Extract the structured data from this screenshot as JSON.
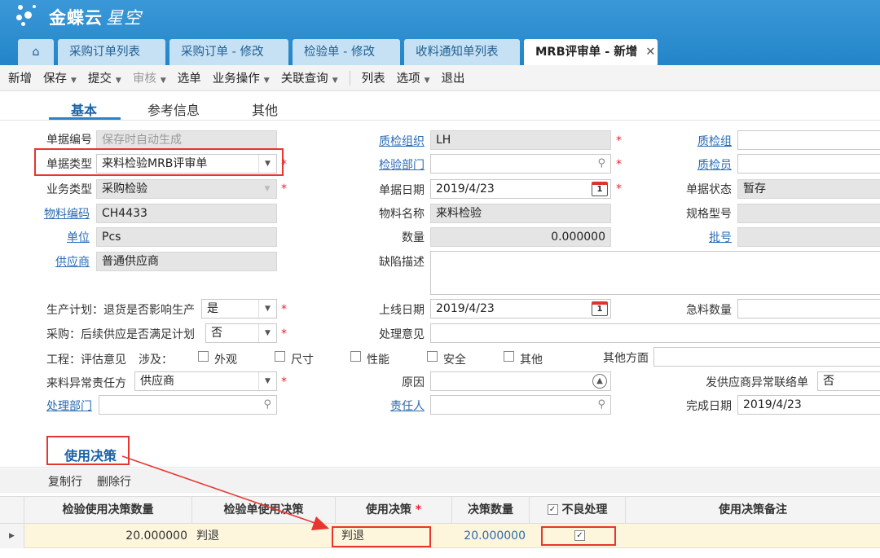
{
  "app": {
    "logo_text": "金蝶云",
    "logo_sub": "星空"
  },
  "tabs": [
    {
      "label": "采购订单列表"
    },
    {
      "label": "采购订单 - 修改"
    },
    {
      "label": "检验单 - 修改"
    },
    {
      "label": "收料通知单列表"
    },
    {
      "label": "MRB评审单 - 新增",
      "active": true
    }
  ],
  "toolbar": {
    "new": "新增",
    "save": "保存",
    "submit": "提交",
    "audit": "审核",
    "select": "选单",
    "business": "业务操作",
    "related": "关联查询",
    "list": "列表",
    "options": "选项",
    "exit": "退出"
  },
  "form_tabs": {
    "basic": "基本",
    "ref": "参考信息",
    "other": "其他"
  },
  "form": {
    "bill_no": {
      "label": "单据编号",
      "placeholder": "保存时自动生成"
    },
    "bill_type": {
      "label": "单据类型",
      "value": "来料检验MRB评审单"
    },
    "biz_type": {
      "label": "业务类型",
      "value": "采购检验"
    },
    "material_code": {
      "label": "物料编码",
      "value": "CH4433"
    },
    "unit": {
      "label": "单位",
      "value": "Pcs"
    },
    "supplier": {
      "label": "供应商",
      "value": "普通供应商"
    },
    "qc_org": {
      "label": "质检组织",
      "value": "LH"
    },
    "insp_dept": {
      "label": "检验部门",
      "value": ""
    },
    "bill_date": {
      "label": "单据日期",
      "value": "2019/4/23"
    },
    "material_name": {
      "label": "物料名称",
      "value": "来料检验"
    },
    "qty": {
      "label": "数量",
      "value": "0.000000"
    },
    "defect_desc": {
      "label": "缺陷描述",
      "value": ""
    },
    "qc_group": {
      "label": "质检组",
      "value": ""
    },
    "inspector": {
      "label": "质检员",
      "value": ""
    },
    "bill_status": {
      "label": "单据状态",
      "value": "暂存"
    },
    "spec": {
      "label": "规格型号",
      "value": ""
    },
    "lot": {
      "label": "批号",
      "value": ""
    },
    "prod_plan": {
      "label": "生产计划：退货是否影响生产",
      "value": "是"
    },
    "purchase": {
      "label": "采购：后续供应是否满足计划",
      "value": "否"
    },
    "engineering": {
      "label": "工程：评估意见",
      "involve": "涉及："
    },
    "checks": [
      "外观",
      "尺寸",
      "性能",
      "安全",
      "其他"
    ],
    "other_aspect": {
      "label": "其他方面",
      "value": ""
    },
    "resp_party": {
      "label": "来料异常责任方",
      "value": "供应商"
    },
    "handle_dept": {
      "label": "处理部门",
      "value": ""
    },
    "online_date": {
      "label": "上线日期",
      "value": "2019/4/23"
    },
    "handle_opinion": {
      "label": "处理意见",
      "value": ""
    },
    "reason": {
      "label": "原因",
      "value": ""
    },
    "responsible": {
      "label": "责任人",
      "value": ""
    },
    "urgent_qty": {
      "label": "急料数量",
      "value": ""
    },
    "send_notice": {
      "label": "发供应商异常联络单",
      "value": "否"
    },
    "finish_date": {
      "label": "完成日期",
      "value": "2019/4/23"
    },
    "calendar_day": "1"
  },
  "detail": {
    "tab": "使用决策",
    "copy_row": "复制行",
    "delete_row": "删除行",
    "columns": [
      "检验使用决策数量",
      "检验单使用决策",
      "使用决策",
      "决策数量",
      "不良处理",
      "使用决策备注"
    ],
    "row": {
      "qty": "20.000000",
      "insp_decision": "判退",
      "decision": "判退",
      "decision_qty": "20.000000",
      "defect_handle": true,
      "remark": ""
    }
  }
}
